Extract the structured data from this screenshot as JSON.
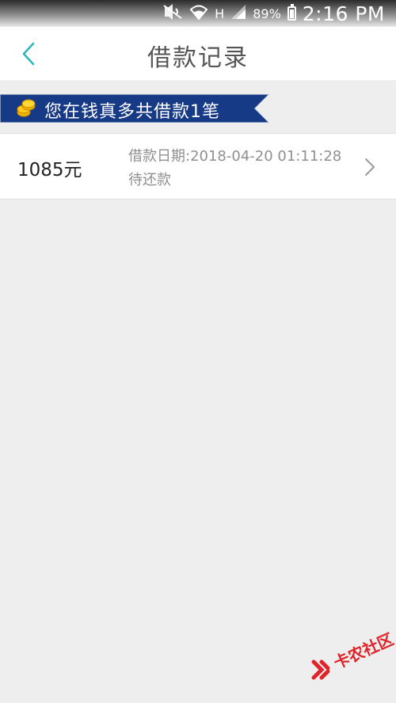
{
  "status_bar": {
    "battery": "89%",
    "network": "H",
    "time": "2:16 PM"
  },
  "nav": {
    "title": "借款记录"
  },
  "banner": {
    "text": "您在钱真多共借款1笔"
  },
  "loan_records": [
    {
      "amount": "1085元",
      "date_label": "借款日期:",
      "date": "2018-04-20 01:11:28",
      "status": "待还款"
    }
  ],
  "watermark": {
    "text": "卡农社区"
  },
  "colors": {
    "accent": "#2ab7b7",
    "banner_bg": "#173a86",
    "coin": "#f5b800",
    "watermark": "#e0232b"
  }
}
